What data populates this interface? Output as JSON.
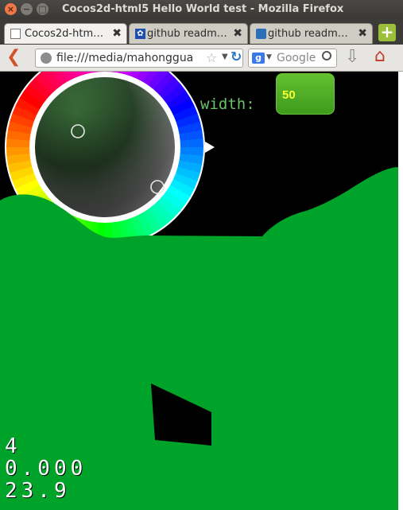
{
  "window": {
    "title": "Cocos2d-html5 Hello World test - Mozilla Firefox"
  },
  "tabs": [
    {
      "label": "Cocos2d-htm…",
      "active": true,
      "icon": "blank-page-icon"
    },
    {
      "label": "github readm…",
      "active": false,
      "icon": "paw-icon"
    },
    {
      "label": "github readm…",
      "active": false,
      "icon": "notes-icon"
    }
  ],
  "navbar": {
    "url": "file:///media/mahonggua",
    "search_placeholder": "Google",
    "search_engine_letter": "g"
  },
  "canvas": {
    "width_label": "width:",
    "width_value": "50",
    "stats": [
      "4",
      "0.000",
      "23.9"
    ]
  },
  "colors": {
    "ground": "#00a32a",
    "background": "#000000",
    "button_green": "#4caf26",
    "label_green": "#6ac26a",
    "button_text": "#f7ff2e"
  }
}
